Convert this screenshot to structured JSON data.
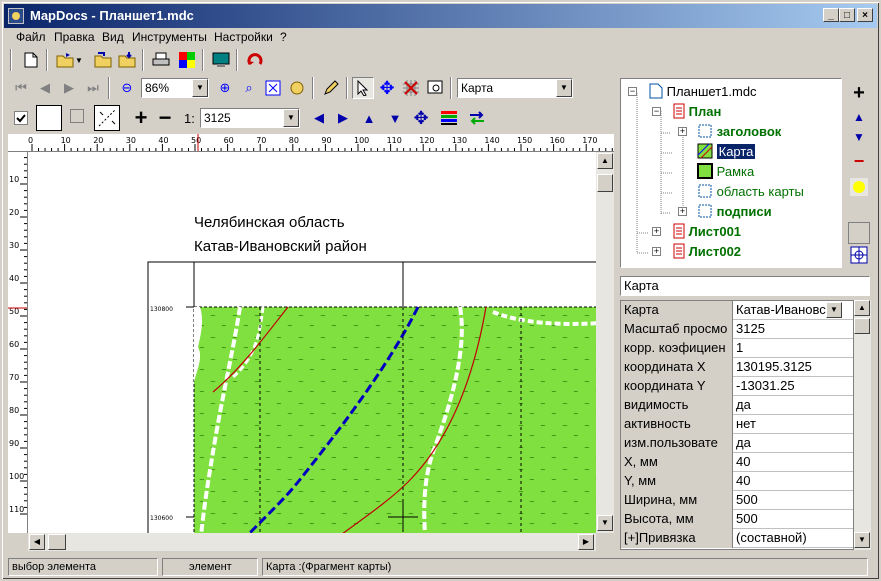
{
  "window": {
    "title": "MapDocs - Планшет1.mdc"
  },
  "menu": [
    "Файл",
    "Правка",
    "Вид",
    "Инструменты",
    "Настройки",
    "?"
  ],
  "toolbar2": {
    "zoom": "86%",
    "layer": "Карта"
  },
  "toolbar3": {
    "scale_prefix": "1:",
    "scale": "3125"
  },
  "ruler": {
    "top": [
      "0",
      "10",
      "20",
      "30",
      "40",
      "50",
      "60",
      "70",
      "80",
      "90",
      "100",
      "110",
      "120",
      "130",
      "140",
      "150",
      "160",
      "170"
    ],
    "left": [
      "10",
      "20",
      "30",
      "40",
      "50",
      "60",
      "70",
      "80",
      "90",
      "100",
      "110"
    ]
  },
  "map": {
    "title1": "Челябинская область",
    "title2": "Катав-Ивановский район",
    "coord1": "130800",
    "coord2": "130600",
    "colors": {
      "land": "#80e040",
      "road": "#0000c0",
      "river": "#c00000"
    }
  },
  "tree": {
    "root": "Планшет1.mdc",
    "plan": "План",
    "header": "заголовок",
    "map": "Карта",
    "frame": "Рамка",
    "map_area": "область карты",
    "captions": "подписи",
    "sheet1": "Лист001",
    "sheet2": "Лист002"
  },
  "props": {
    "title": "Карта",
    "rows": [
      {
        "name": "Карта",
        "value": "Катав-Ивановс"
      },
      {
        "name": "Масштаб просмо",
        "value": "3125"
      },
      {
        "name": "корр. коэфициен",
        "value": "1"
      },
      {
        "name": "координата X",
        "value": "130195.3125"
      },
      {
        "name": "координата Y",
        "value": "-13031.25"
      },
      {
        "name": "видимость",
        "value": "да"
      },
      {
        "name": "активность",
        "value": "нет"
      },
      {
        "name": "изм.пользовате",
        "value": "да"
      },
      {
        "name": "X, мм",
        "value": "40"
      },
      {
        "name": "Y, мм",
        "value": "40"
      },
      {
        "name": "Ширина, мм",
        "value": "500"
      },
      {
        "name": "Высота, мм",
        "value": "500"
      },
      {
        "name": "[+]Привязка",
        "value": "(составной)"
      }
    ]
  },
  "status": {
    "mode": "выбор элемента",
    "type": "элемент",
    "info": "Карта :(Фрагмент карты)"
  }
}
